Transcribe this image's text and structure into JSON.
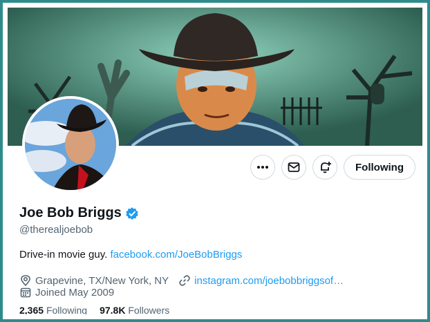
{
  "profile": {
    "display_name": "Joe Bob Briggs",
    "handle": "@therealjoebob",
    "bio_text": "Drive-in movie guy.",
    "bio_link": "facebook.com/JoeBobBriggs",
    "location": "Grapevine, TX/New York, NY",
    "website": "instagram.com/joebobbriggsof…",
    "joined": "Joined May 2009",
    "verified_icon": "verified-badge-icon",
    "accent_color": "#1d9bf0"
  },
  "actions": {
    "more_icon": "more-icon",
    "message_icon": "message-icon",
    "notify_icon": "notify-bell-icon",
    "following_label": "Following"
  },
  "stats": {
    "following_count": "2,365",
    "following_label": "Following",
    "followers_count": "97.8K",
    "followers_label": "Followers"
  }
}
